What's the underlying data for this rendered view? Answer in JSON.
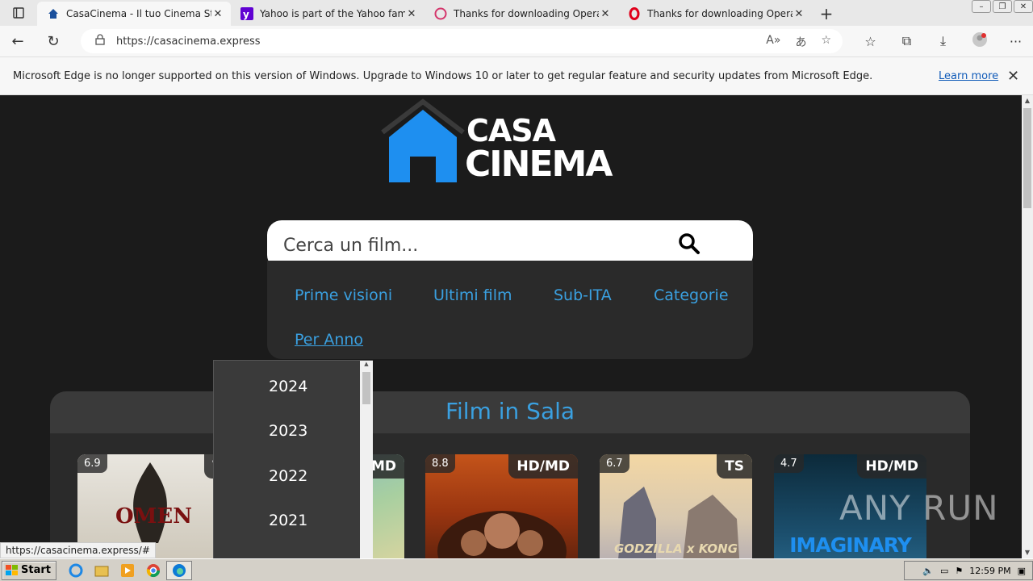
{
  "browser": {
    "tabs": [
      {
        "title": "CasaCinema - Il tuo Cinema Stre",
        "active": true
      },
      {
        "title": "Yahoo is part of the Yahoo family",
        "active": false
      },
      {
        "title": "Thanks for downloading Opera",
        "active": false
      },
      {
        "title": "Thanks for downloading Opera",
        "active": false
      }
    ],
    "new_tab_label": "+",
    "url": "https://casacinema.express",
    "infobar_message": "Microsoft Edge is no longer supported on this version of Windows. Upgrade to Windows 10 or later to get regular feature and security updates from Microsoft Edge.",
    "infobar_link": "Learn more",
    "status_url": "https://casacinema.express/#"
  },
  "site": {
    "logo_top": "CASA",
    "logo_bottom": "CINEMA",
    "search_placeholder": "Cerca un film...",
    "menu": [
      "Prime visioni",
      "Ultimi film",
      "Sub-ITA",
      "Categorie",
      "Per Anno"
    ],
    "year_dropdown": [
      "2024",
      "2023",
      "2022",
      "2021"
    ],
    "section_title": "Film in Sala",
    "movies": [
      {
        "rating": "6.9",
        "quality": "T",
        "title": "OMEN"
      },
      {
        "rating": "",
        "quality": "MD",
        "title": ""
      },
      {
        "rating": "8.8",
        "quality": "HD/MD",
        "title": ""
      },
      {
        "rating": "6.7",
        "quality": "TS",
        "title": "GODZILLA x KONG"
      },
      {
        "rating": "4.7",
        "quality": "HD/MD",
        "title": "IMAGINARY"
      }
    ]
  },
  "watermark": "ANY RUN",
  "taskbar": {
    "start_label": "Start",
    "clock": "12:59 PM"
  }
}
